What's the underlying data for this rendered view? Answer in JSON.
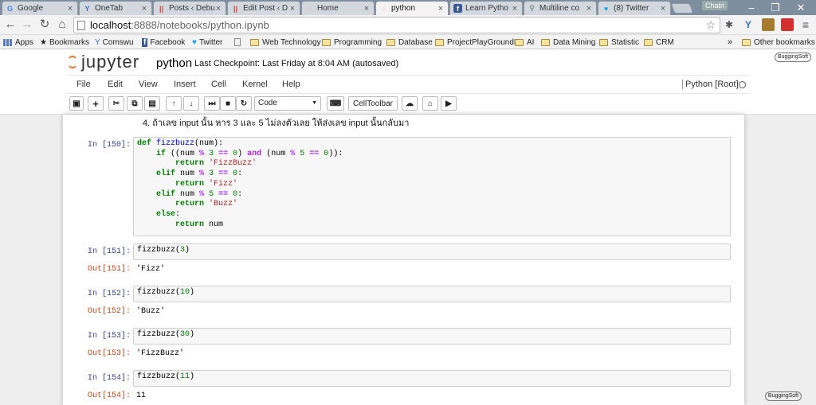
{
  "browser": {
    "tabs": [
      {
        "label": "Google",
        "icon": "G",
        "color": "#4285f4"
      },
      {
        "label": "OneTab",
        "icon": "Y",
        "color": "#3b6fc4"
      },
      {
        "label": "Posts ‹ Debu",
        "icon": "||",
        "color": "#d04040"
      },
      {
        "label": "Edit Post ‹ D",
        "icon": "||",
        "color": "#d04040"
      },
      {
        "label": "Home",
        "icon": "◌",
        "color": "#f37726"
      },
      {
        "label": "python",
        "icon": "◌",
        "color": "#f37726"
      },
      {
        "label": "Learn Pytho",
        "icon": "f",
        "color": "#3b5998"
      },
      {
        "label": "Multiline co",
        "icon": "⚲",
        "color": "#888888"
      },
      {
        "label": "(8) Twitter",
        "icon": "♥",
        "color": "#1da1f2"
      }
    ],
    "profile": "Chatri",
    "url_host": "localhost",
    "url_path": ":8888/notebooks/python.ipynb",
    "bookmarks": {
      "apps": "Apps",
      "items": [
        "Bookmarks",
        "Comswu",
        "Facebook",
        "Twitter"
      ],
      "folders": [
        "Web Technology",
        "Programming",
        "Database",
        "ProjectPlayGroundD",
        "AI",
        "Data Mining",
        "Statistic",
        "CRM"
      ],
      "overflow": "»",
      "other": "Other bookmarks"
    }
  },
  "jupyter": {
    "logo": "jupyter",
    "notebook_name": "python",
    "checkpoint": "Last Checkpoint: Last Friday at 8:04 AM (autosaved)",
    "menu": [
      "File",
      "Edit",
      "View",
      "Insert",
      "Cell",
      "Kernel",
      "Help"
    ],
    "kernel": "Python [Root]",
    "cell_type": "Code",
    "celltoolbar": "CellToolbar",
    "badge": "BuggingSoft"
  },
  "notebook": {
    "markdown_line": "4. ถ้าเลข input นั้น หาร 3 และ 5 ไม่ลงตัวเลย ให้ส่งเลข input นั้นกลับมา",
    "def_cell": {
      "prompt": "In [150]:"
    },
    "cells": [
      {
        "in_prompt": "In [151]:",
        "fn": "fizzbuzz",
        "arg": "3",
        "out_prompt": "Out[151]:",
        "output": "'Fizz'"
      },
      {
        "in_prompt": "In [152]:",
        "fn": "fizzbuzz",
        "arg": "10",
        "out_prompt": "Out[152]:",
        "output": "'Buzz'"
      },
      {
        "in_prompt": "In [153]:",
        "fn": "fizzbuzz",
        "arg": "30",
        "out_prompt": "Out[153]:",
        "output": "'FizzBuzz'"
      },
      {
        "in_prompt": "In [154]:",
        "fn": "fizzbuzz",
        "arg": "11",
        "out_prompt": "Out[154]:",
        "output": "11"
      }
    ]
  }
}
